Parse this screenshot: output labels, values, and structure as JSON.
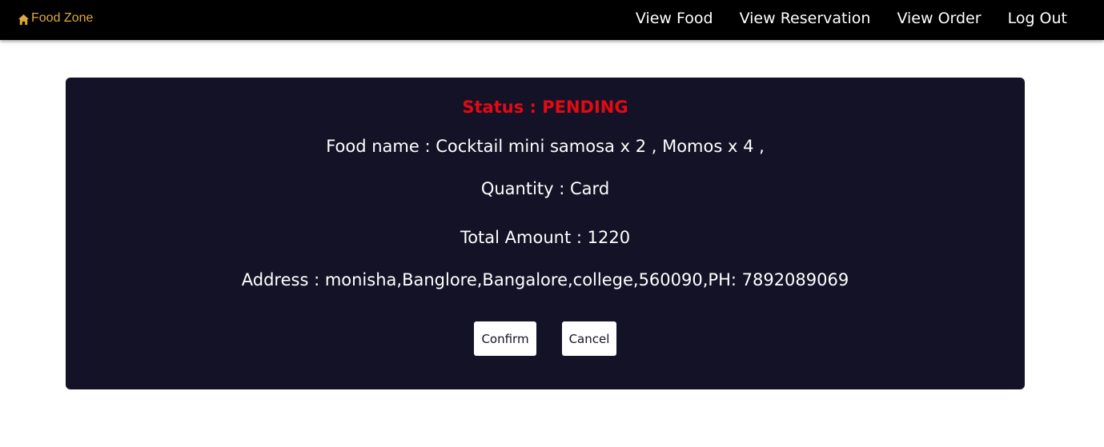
{
  "brand": {
    "name": "Food Zone",
    "icon": "home-icon",
    "color": "#e0a93a"
  },
  "nav": {
    "items": [
      {
        "label": "View Food"
      },
      {
        "label": "View Reservation"
      },
      {
        "label": "View Order"
      },
      {
        "label": "Log Out"
      }
    ]
  },
  "order": {
    "status_text": "Status : PENDING",
    "status_color": "#e50914",
    "food_text": "Food name : Cocktail mini samosa x 2 , Momos x 4 ,",
    "quantity_text": "Quantity : Card",
    "amount_text": "Total Amount : 1220",
    "address_text": "Address : monisha,Banglore,Bangalore,college,560090,PH: 7892089069",
    "card_color": "#141226"
  },
  "actions": {
    "confirm_label": "Confirm",
    "cancel_label": "Cancel"
  }
}
